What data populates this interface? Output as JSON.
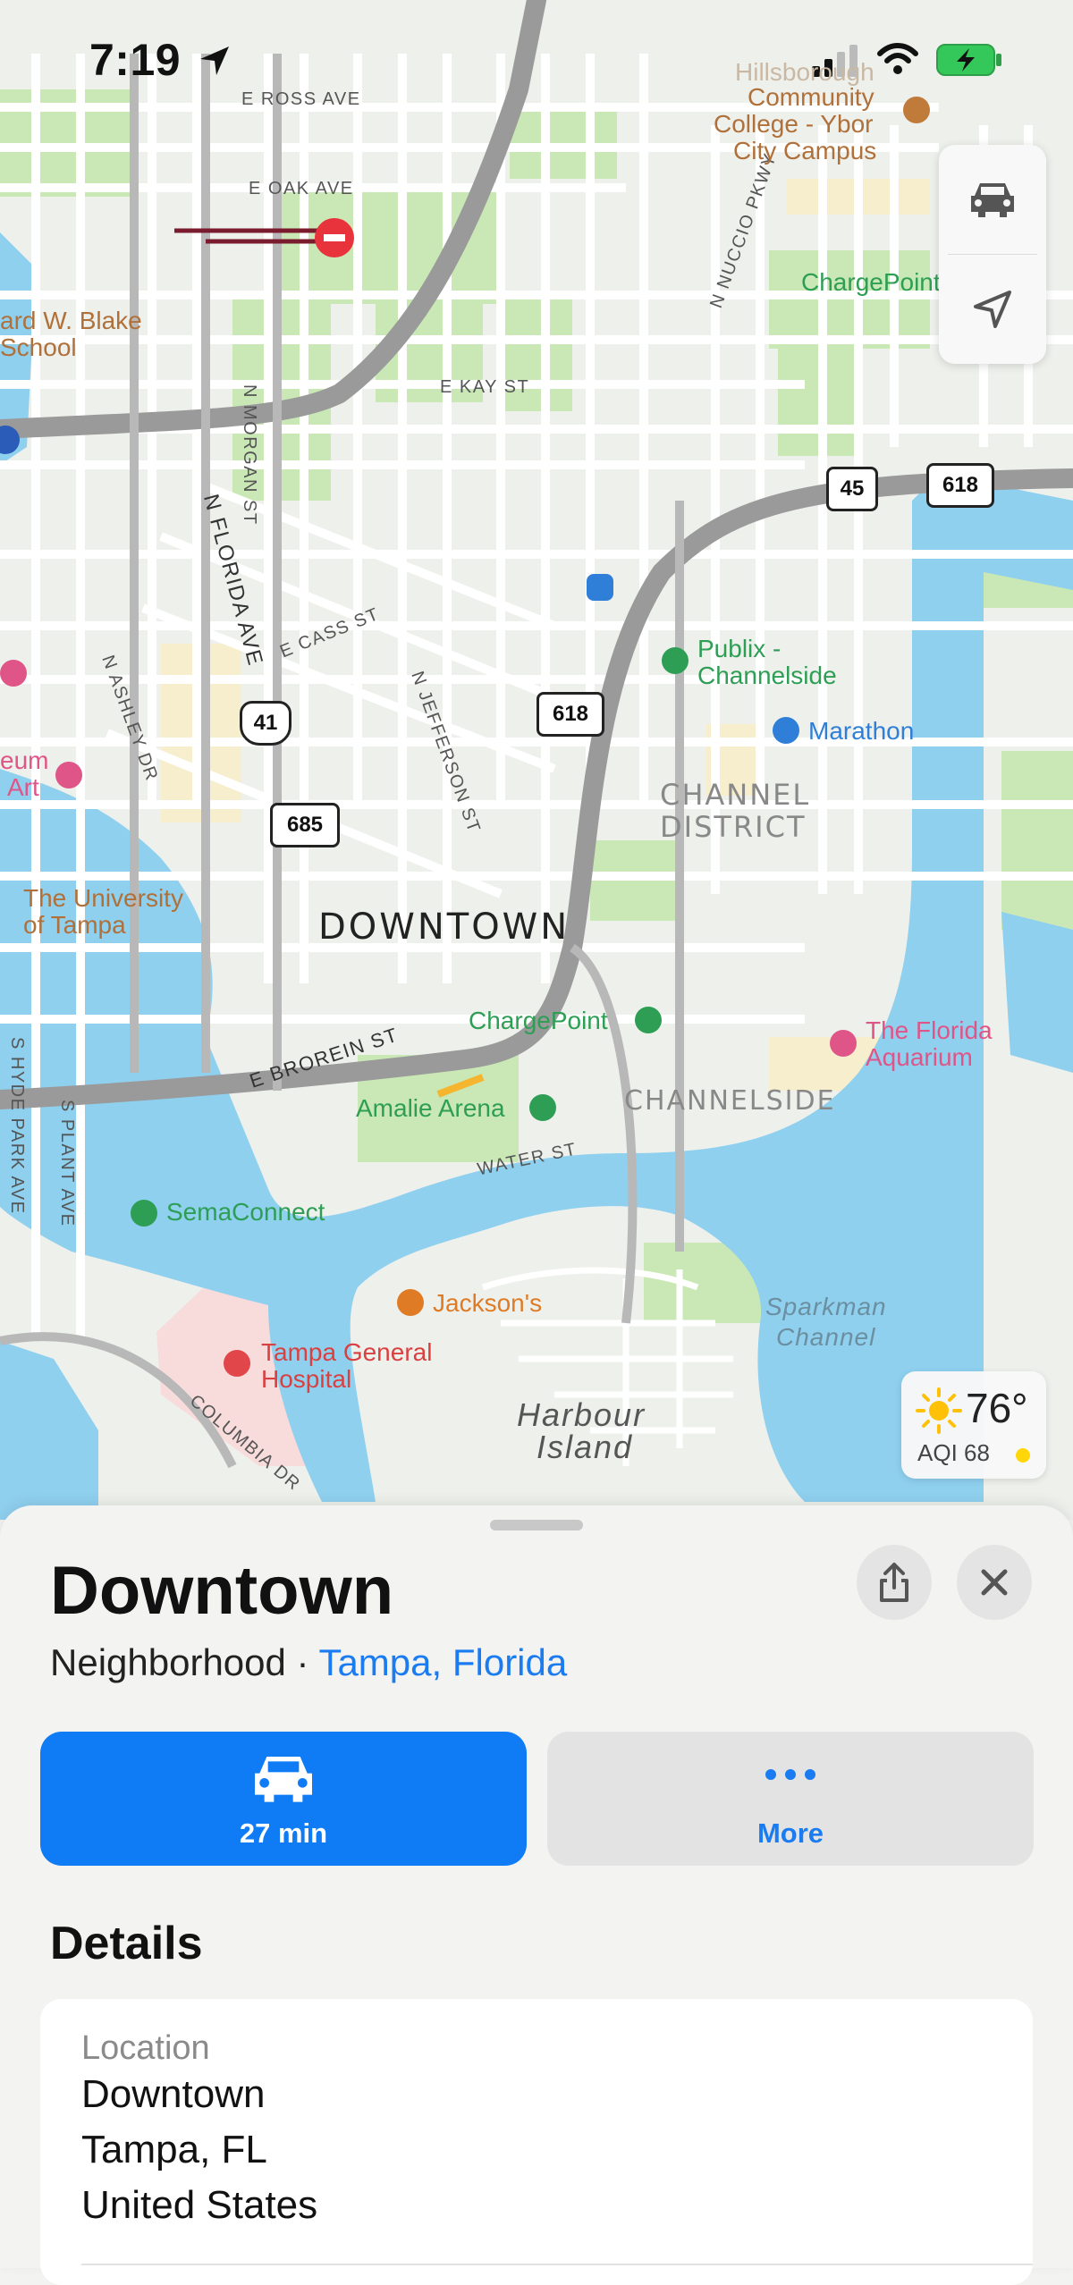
{
  "status_bar": {
    "time": "7:19"
  },
  "map": {
    "streets": {
      "ross": "E ROSS AVE",
      "oak": "E OAK AVE",
      "kay": "E KAY ST",
      "nuccio": "N NUCCIO PKWY",
      "morgan": "N MORGAN ST",
      "florida": "N FLORIDA AVE",
      "cass": "E CASS ST",
      "ashley": "N ASHLEY DR",
      "jefferson": "N JEFFERSON ST",
      "brorein": "E BROREIN ST",
      "water": "WATER ST",
      "hyde_park": "S HYDE PARK AVE",
      "plant": "S PLANT AVE",
      "columbia": "COLUMBIA DR"
    },
    "districts": {
      "downtown": "DOWNTOWN",
      "channel_district_1": "CHANNEL",
      "channel_district_2": "DISTRICT",
      "channelside": "CHANNELSIDE",
      "harbour_island_1": "Harbour",
      "harbour_island_2": "Island",
      "sparkman_1": "Sparkman",
      "sparkman_2": "Channel"
    },
    "pois": {
      "hcc_1": "Hillsborough",
      "hcc_2": "Community",
      "hcc_3": "College - Ybor",
      "hcc_4": "City Campus",
      "chargepoint_top": "ChargePoint",
      "blake_1": "ard W. Blake",
      "blake_2": "School",
      "publix_1": "Publix -",
      "publix_2": "Channelside",
      "marathon": "Marathon",
      "museum_1": "eum",
      "museum_2": "Art",
      "ut_1": "The University",
      "ut_2": "of Tampa",
      "chargepoint_mid": "ChargePoint",
      "aquarium_1": "The Florida",
      "aquarium_2": "Aquarium",
      "amalie": "Amalie Arena",
      "semaconnect": "SemaConnect",
      "jacksons": "Jackson's",
      "tgh_1": "Tampa General",
      "tgh_2": "Hospital"
    },
    "shields": {
      "s45": "45",
      "s618a": "618",
      "s618b": "618",
      "s41": "41",
      "s685": "685"
    },
    "weather": {
      "temp": "76°",
      "aqi": "AQI 68",
      "aqi_color": "#ffd60a"
    }
  },
  "sheet": {
    "title": "Downtown",
    "subtitle_type": "Neighborhood · ",
    "subtitle_link": "Tampa, Florida",
    "directions": {
      "label": "27 min",
      "color": "#0f7cf6"
    },
    "more": {
      "label": "More"
    },
    "details_heading": "Details",
    "location_card": {
      "label": "Location",
      "line1": "Downtown",
      "line2": "Tampa, FL",
      "line3": "United States"
    }
  }
}
